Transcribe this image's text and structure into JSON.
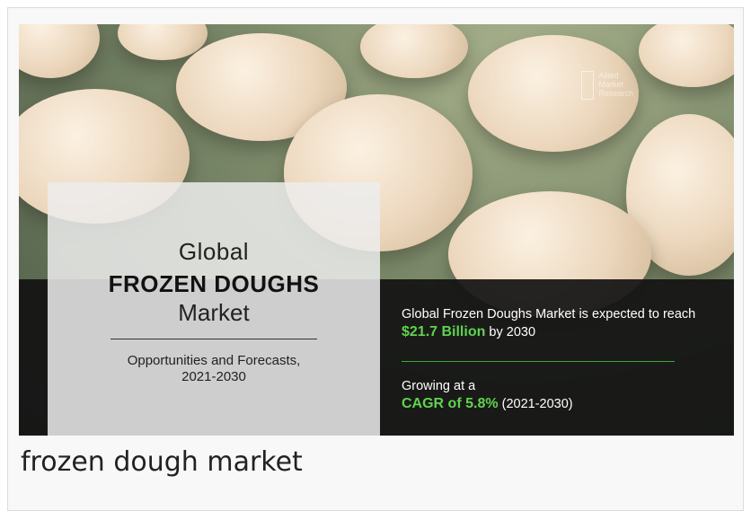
{
  "infographic": {
    "watermark": {
      "line1": "Allied",
      "line2": "Market",
      "line3": "Research"
    },
    "left_panel": {
      "line1": "Global",
      "line2": "FROZEN DOUGHS",
      "line3": "Market",
      "subtitle_line1": "Opportunities and Forecasts,",
      "subtitle_line2": "2021-2030"
    },
    "right_panel": {
      "expected_prefix": "Global Frozen Doughs Market is expected to reach",
      "expected_value": "$21.7 Billion",
      "expected_suffix": "by 2030",
      "growing_label": "Growing at a",
      "cagr_value": "CAGR of 5.8%",
      "cagr_period": "(2021-2030)"
    },
    "colors": {
      "accent": "#5fd34e",
      "band": "#121212",
      "panel": "#ececec"
    },
    "photo": "frozen dough balls on a tray"
  },
  "caption": "frozen dough market"
}
